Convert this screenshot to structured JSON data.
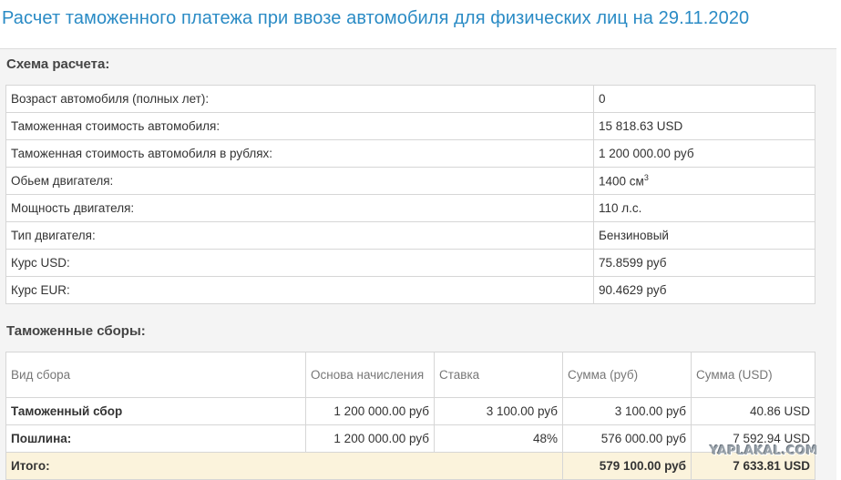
{
  "title": "Расчет таможенного платежа при ввозе автомобиля для физических лиц на 29.11.2020",
  "schema": {
    "heading": "Схема расчета:",
    "rows": [
      {
        "label": "Возраст автомобиля (полных лет):",
        "value": "0"
      },
      {
        "label": "Таможенная стоимость автомобиля:",
        "value": "15 818.63 USD"
      },
      {
        "label": "Таможенная стоимость автомобиля в рублях:",
        "value": "1 200 000.00 руб"
      },
      {
        "label": "Обьем двигателя:",
        "value": "1400 см",
        "value_sup": "3"
      },
      {
        "label": "Мощность двигателя:",
        "value": "110 л.с."
      },
      {
        "label": "Тип двигателя:",
        "value": "Бензиновый"
      },
      {
        "label": "Курс USD:",
        "value": "75.8599 руб"
      },
      {
        "label": "Курс EUR:",
        "value": "90.4629 руб"
      }
    ]
  },
  "fees": {
    "heading": "Таможенные сборы:",
    "columns": [
      "Вид сбора",
      "Основа начисления",
      "Ставка",
      "Сумма (руб)",
      "Сумма (USD)"
    ],
    "rows": [
      {
        "name": "Таможенный сбор",
        "base": "1 200 000.00 руб",
        "rate": "3 100.00 руб",
        "rub": "3 100.00 руб",
        "usd": "40.86 USD"
      },
      {
        "name": "Пошлина:",
        "base": "1 200 000.00 руб",
        "rate": "48%",
        "rub": "576 000.00 руб",
        "usd": "7 592.94 USD"
      }
    ],
    "total": {
      "label": "Итого:",
      "rub": "579 100.00 руб",
      "usd": "7 633.81 USD"
    }
  },
  "watermark": "YAPLAKAL.COM"
}
